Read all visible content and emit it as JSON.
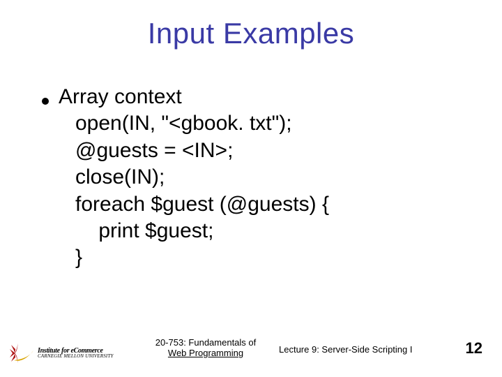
{
  "title": "Input Examples",
  "bullet": "Array context",
  "code": "open(IN, \"<gbook. txt\");\n@guests = <IN>;\nclose(IN);\nforeach $guest (@guests) {\n    print $guest;\n}",
  "footer": {
    "logo": {
      "line1": "Institute for eCommerce",
      "line2": "CARNEGIE MELLON UNIVERSITY"
    },
    "course_line1": "20-753: Fundamentals of",
    "course_line2": "Web Programming",
    "lecture": "Lecture 9: Server-Side Scripting I",
    "page": "12"
  }
}
